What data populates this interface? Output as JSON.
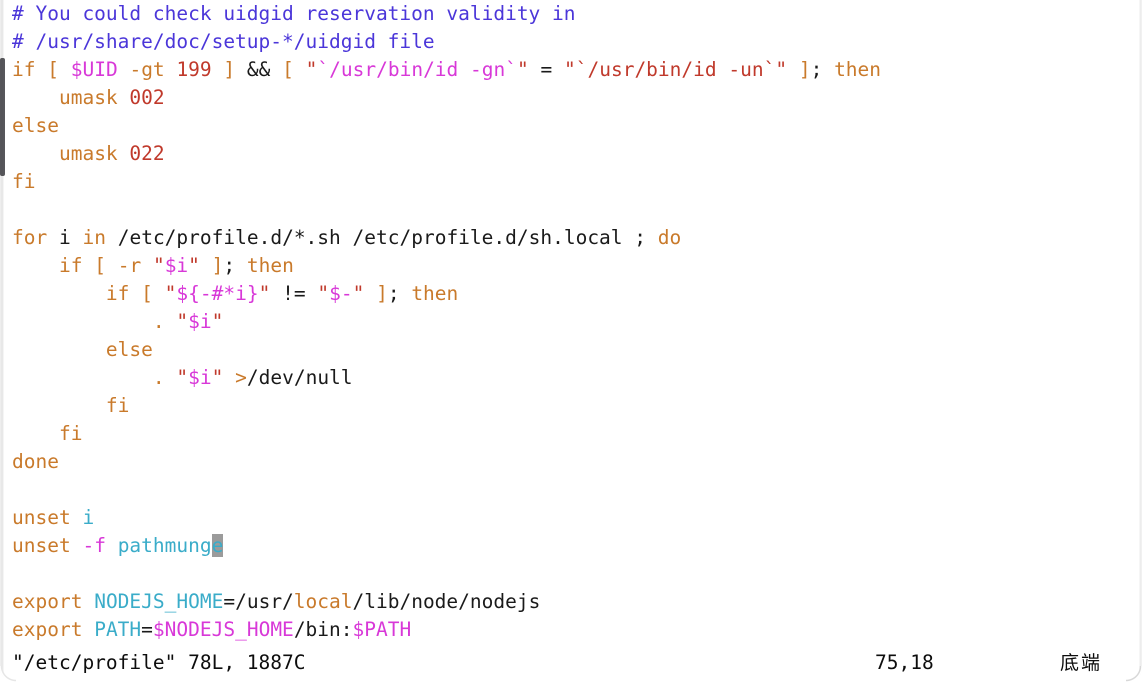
{
  "window": {
    "title": "/etc/profile",
    "accent_comment": "#4b36d9",
    "accent_keyword": "#c97a2b",
    "accent_string": "#c0392b",
    "accent_variable": "#d838d8",
    "accent_identifier": "#3aacc9",
    "background": "#ffffff",
    "foreground": "#1a1a1a",
    "cursor_background": "#9b9b9b"
  },
  "editor": {
    "lines": [
      {
        "id": "l1",
        "indent": "",
        "tokens": [
          {
            "t": "# You could check uidgid reservation validity in",
            "c": "comment"
          }
        ]
      },
      {
        "id": "l2",
        "indent": "",
        "tokens": [
          {
            "t": "# /usr/share/doc/setup-*/uidgid file",
            "c": "comment"
          }
        ]
      },
      {
        "id": "l3",
        "indent": "",
        "tokens": [
          {
            "t": "if",
            "c": "keyword"
          },
          {
            "t": " ",
            "c": "plain"
          },
          {
            "t": "[",
            "c": "keyword"
          },
          {
            "t": " ",
            "c": "plain"
          },
          {
            "t": "$UID",
            "c": "var"
          },
          {
            "t": " ",
            "c": "plain"
          },
          {
            "t": "-gt",
            "c": "keyword"
          },
          {
            "t": " ",
            "c": "plain"
          },
          {
            "t": "199",
            "c": "number"
          },
          {
            "t": " ",
            "c": "plain"
          },
          {
            "t": "]",
            "c": "keyword"
          },
          {
            "t": " ",
            "c": "plain"
          },
          {
            "t": "&&",
            "c": "op"
          },
          {
            "t": " ",
            "c": "plain"
          },
          {
            "t": "[",
            "c": "keyword"
          },
          {
            "t": " ",
            "c": "plain"
          },
          {
            "t": "\"",
            "c": "string"
          },
          {
            "t": "`/usr/bin/id -gn`",
            "c": "var"
          },
          {
            "t": "\"",
            "c": "string"
          },
          {
            "t": " ",
            "c": "plain"
          },
          {
            "t": "=",
            "c": "op"
          },
          {
            "t": " ",
            "c": "plain"
          },
          {
            "t": "\"`/usr/bin/id -un`\"",
            "c": "string"
          },
          {
            "t": " ",
            "c": "plain"
          },
          {
            "t": "]",
            "c": "keyword"
          },
          {
            "t": ";",
            "c": "op"
          },
          {
            "t": " ",
            "c": "plain"
          },
          {
            "t": "then",
            "c": "keyword"
          }
        ]
      },
      {
        "id": "l4",
        "indent": "    ",
        "tokens": [
          {
            "t": "umask",
            "c": "keyword"
          },
          {
            "t": " ",
            "c": "plain"
          },
          {
            "t": "002",
            "c": "number"
          }
        ]
      },
      {
        "id": "l5",
        "indent": "",
        "tokens": [
          {
            "t": "else",
            "c": "keyword"
          }
        ]
      },
      {
        "id": "l6",
        "indent": "    ",
        "tokens": [
          {
            "t": "umask",
            "c": "keyword"
          },
          {
            "t": " ",
            "c": "plain"
          },
          {
            "t": "022",
            "c": "number"
          }
        ]
      },
      {
        "id": "l7",
        "indent": "",
        "tokens": [
          {
            "t": "fi",
            "c": "keyword"
          }
        ]
      },
      {
        "id": "l8",
        "indent": "",
        "tokens": []
      },
      {
        "id": "l9",
        "indent": "",
        "tokens": [
          {
            "t": "for",
            "c": "keyword"
          },
          {
            "t": " ",
            "c": "plain"
          },
          {
            "t": "i",
            "c": "plain"
          },
          {
            "t": " ",
            "c": "plain"
          },
          {
            "t": "in",
            "c": "keyword"
          },
          {
            "t": " ",
            "c": "plain"
          },
          {
            "t": "/etc/profile.d/*.sh /etc/profile.d/sh.local",
            "c": "plain"
          },
          {
            "t": " ",
            "c": "plain"
          },
          {
            "t": ";",
            "c": "op"
          },
          {
            "t": " ",
            "c": "plain"
          },
          {
            "t": "do",
            "c": "keyword"
          }
        ]
      },
      {
        "id": "l10",
        "indent": "    ",
        "tokens": [
          {
            "t": "if",
            "c": "keyword"
          },
          {
            "t": " ",
            "c": "plain"
          },
          {
            "t": "[",
            "c": "keyword"
          },
          {
            "t": " ",
            "c": "plain"
          },
          {
            "t": "-r",
            "c": "keyword"
          },
          {
            "t": " ",
            "c": "plain"
          },
          {
            "t": "\"",
            "c": "string"
          },
          {
            "t": "$i",
            "c": "var"
          },
          {
            "t": "\"",
            "c": "string"
          },
          {
            "t": " ",
            "c": "plain"
          },
          {
            "t": "]",
            "c": "keyword"
          },
          {
            "t": ";",
            "c": "op"
          },
          {
            "t": " ",
            "c": "plain"
          },
          {
            "t": "then",
            "c": "keyword"
          }
        ]
      },
      {
        "id": "l11",
        "indent": "        ",
        "tokens": [
          {
            "t": "if",
            "c": "keyword"
          },
          {
            "t": " ",
            "c": "plain"
          },
          {
            "t": "[",
            "c": "keyword"
          },
          {
            "t": " ",
            "c": "plain"
          },
          {
            "t": "\"",
            "c": "string"
          },
          {
            "t": "${-#*i}",
            "c": "var"
          },
          {
            "t": "\"",
            "c": "string"
          },
          {
            "t": " ",
            "c": "plain"
          },
          {
            "t": "!=",
            "c": "op"
          },
          {
            "t": " ",
            "c": "plain"
          },
          {
            "t": "\"",
            "c": "string"
          },
          {
            "t": "$-",
            "c": "var"
          },
          {
            "t": "\"",
            "c": "string"
          },
          {
            "t": " ",
            "c": "plain"
          },
          {
            "t": "]",
            "c": "keyword"
          },
          {
            "t": ";",
            "c": "op"
          },
          {
            "t": " ",
            "c": "plain"
          },
          {
            "t": "then",
            "c": "keyword"
          }
        ]
      },
      {
        "id": "l12",
        "indent": "            ",
        "tokens": [
          {
            "t": ".",
            "c": "keyword"
          },
          {
            "t": " ",
            "c": "plain"
          },
          {
            "t": "\"",
            "c": "string"
          },
          {
            "t": "$i",
            "c": "var"
          },
          {
            "t": "\"",
            "c": "string"
          }
        ]
      },
      {
        "id": "l13",
        "indent": "        ",
        "tokens": [
          {
            "t": "else",
            "c": "keyword"
          }
        ]
      },
      {
        "id": "l14",
        "indent": "            ",
        "tokens": [
          {
            "t": ".",
            "c": "keyword"
          },
          {
            "t": " ",
            "c": "plain"
          },
          {
            "t": "\"",
            "c": "string"
          },
          {
            "t": "$i",
            "c": "var"
          },
          {
            "t": "\"",
            "c": "string"
          },
          {
            "t": " ",
            "c": "plain"
          },
          {
            "t": ">",
            "c": "keyword"
          },
          {
            "t": "/dev/null",
            "c": "plain"
          }
        ]
      },
      {
        "id": "l15",
        "indent": "        ",
        "tokens": [
          {
            "t": "fi",
            "c": "keyword"
          }
        ]
      },
      {
        "id": "l16",
        "indent": "    ",
        "tokens": [
          {
            "t": "fi",
            "c": "keyword"
          }
        ]
      },
      {
        "id": "l17",
        "indent": "",
        "tokens": [
          {
            "t": "done",
            "c": "keyword"
          }
        ]
      },
      {
        "id": "l18",
        "indent": "",
        "tokens": []
      },
      {
        "id": "l19",
        "indent": "",
        "tokens": [
          {
            "t": "unset",
            "c": "keyword"
          },
          {
            "t": " ",
            "c": "plain"
          },
          {
            "t": "i",
            "c": "ident"
          }
        ]
      },
      {
        "id": "l20",
        "indent": "",
        "tokens": [
          {
            "t": "unset",
            "c": "keyword"
          },
          {
            "t": " ",
            "c": "plain"
          },
          {
            "t": "-f",
            "c": "var"
          },
          {
            "t": " ",
            "c": "plain"
          },
          {
            "t": "pathmung",
            "c": "ident"
          },
          {
            "t": "e",
            "c": "ident",
            "cursor": true
          }
        ]
      },
      {
        "id": "l21",
        "indent": "",
        "tokens": []
      },
      {
        "id": "l22",
        "indent": "",
        "tokens": [
          {
            "t": "export",
            "c": "keyword"
          },
          {
            "t": " ",
            "c": "plain"
          },
          {
            "t": "NODEJS_HOME",
            "c": "ident"
          },
          {
            "t": "=",
            "c": "plain"
          },
          {
            "t": "/usr/",
            "c": "plain"
          },
          {
            "t": "local",
            "c": "keyword"
          },
          {
            "t": "/lib/node/nodejs",
            "c": "plain"
          }
        ]
      },
      {
        "id": "l23",
        "indent": "",
        "tokens": [
          {
            "t": "export",
            "c": "keyword"
          },
          {
            "t": " ",
            "c": "plain"
          },
          {
            "t": "PATH",
            "c": "ident"
          },
          {
            "t": "=",
            "c": "plain"
          },
          {
            "t": "$NODEJS_HOME",
            "c": "var"
          },
          {
            "t": "/bin:",
            "c": "plain"
          },
          {
            "t": "$PATH",
            "c": "var"
          }
        ]
      }
    ]
  },
  "status_bar": {
    "file_info": "\"/etc/profile\" 78L, 1887C",
    "cursor_position": "75,18",
    "scroll_indicator": "底端"
  }
}
